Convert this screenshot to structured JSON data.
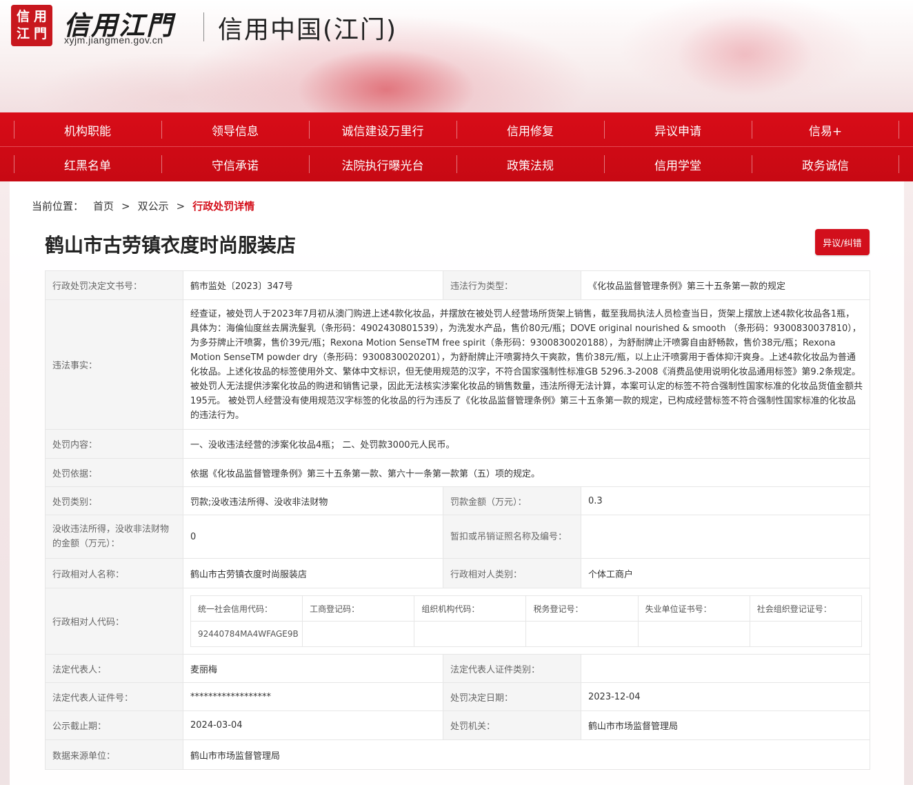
{
  "header": {
    "seal_chars": [
      "信",
      "用",
      "江",
      "門"
    ],
    "brand_name": "信用江門",
    "brand_url": "xyjm.jiangmen.gov.cn",
    "site_title": "信用中国(江门)"
  },
  "nav": {
    "row1": [
      "机构职能",
      "领导信息",
      "诚信建设万里行",
      "信用修复",
      "异议申请",
      "信易+"
    ],
    "row2": [
      "红黑名单",
      "守信承诺",
      "法院执行曝光台",
      "政策法规",
      "信用学堂",
      "政务诚信"
    ]
  },
  "breadcrumb": {
    "label": "当前位置：",
    "items": [
      "首页",
      "双公示",
      "行政处罚详情"
    ],
    "separator": ">"
  },
  "page_title": "鹤山市古劳镇衣度时尚服装店",
  "objection_button": "异议/纠错",
  "detail": {
    "doc_no_label": "行政处罚决定文书号：",
    "doc_no": "鹤市监处〔2023〕347号",
    "violation_type_label": "违法行为类型：",
    "violation_type": "《化妆品监督管理条例》第三十五条第一款的规定",
    "facts_label": "违法事实：",
    "facts": "经查证，被处罚人于2023年7月初从澳门购进上述4款化妆品，并摆放在被处罚人经营场所货架上销售，截至我局执法人员检查当日，货架上摆放上述4款化妆品各1瓶，具体为：海倫仙度丝去屑洗髮乳（条形码：4902430801539），为洗发水产品，售价80元/瓶；DOVE original nourished & smooth （条形码：9300830037810），为多芬牌止汗喷雾，售价39元/瓶；Rexona Motion SenseTM free spirit（条形码：9300830020188），为舒耐牌止汗喷雾自由舒畅款，售价38元/瓶；Rexona Motion SenseTM powder dry（条形码：9300830020201），为舒耐牌止汗喷雾持久干爽款，售价38元/瓶，以上止汗喷雾用于香体抑汗爽身。上述4款化妆品为普通化妆品。上述化妆品的标签使用外文、繁体中文标识，但无使用规范的汉字，不符合国家强制性标准GB 5296.3-2008《消费品使用说明化妆品通用标签》第9.2条规定。被处罚人无法提供涉案化妆品的购进和销售记录，因此无法核实涉案化妆品的销售数量，违法所得无法计算，本案可认定的标签不符合强制性国家标准的化妆品货值金额共195元。 被处罚人经营没有使用规范汉字标签的化妆品的行为违反了《化妆品监督管理条例》第三十五条第一款的规定，已构成经营标签不符合强制性国家标准的化妆品的违法行为。",
    "content_label": "处罚内容：",
    "content": "一、没收违法经营的涉案化妆品4瓶； 二、处罚款3000元人民币。",
    "basis_label": "处罚依据：",
    "basis": "依据《化妆品监督管理条例》第三十五条第一款、第六十一条第一款第（五）项的规定。",
    "category_label": "处罚类别：",
    "category": "罚款;没收违法所得、没收非法财物",
    "fine_label": "罚款金额（万元）：",
    "fine": "0.3",
    "confiscation_label": "没收违法所得，没收非法财物的金额（万元）：",
    "confiscation": "0",
    "license_label": "暂扣或吊销证照名称及编号：",
    "license": "",
    "party_name_label": "行政相对人名称：",
    "party_name": "鹤山市古劳镇衣度时尚服装店",
    "party_type_label": "行政相对人类别：",
    "party_type": "个体工商户",
    "party_code_label": "行政相对人代码：",
    "codes": {
      "headers": [
        "统一社会信用代码：",
        "工商登记码：",
        "组织机构代码：",
        "税务登记号：",
        "失业单位证书号：",
        "社会组织登记证号："
      ],
      "values": [
        "92440784MA4WFAGE9B",
        "",
        "",
        "",
        "",
        ""
      ]
    },
    "legal_rep_label": "法定代表人：",
    "legal_rep": "麦丽梅",
    "legal_rep_id_type_label": "法定代表人证件类别：",
    "legal_rep_id_type": "",
    "legal_rep_id_label": "法定代表人证件号：",
    "legal_rep_id": "******************",
    "decision_date_label": "处罚决定日期：",
    "decision_date": "2023-12-04",
    "publicity_end_label": "公示截止期：",
    "publicity_end": "2024-03-04",
    "authority_label": "处罚机关：",
    "authority": "鹤山市市场监督管理局",
    "source_label": "数据来源单位：",
    "source": "鹤山市市场监督管理局"
  }
}
